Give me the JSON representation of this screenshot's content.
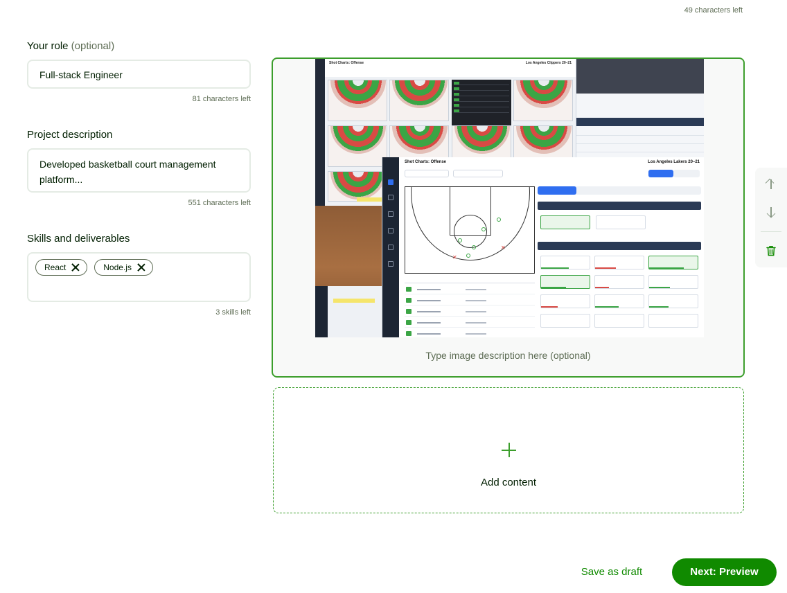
{
  "header": {
    "chars_left": "49 characters left"
  },
  "role": {
    "label": "Your role",
    "optional": "(optional)",
    "value": "Full-stack Engineer",
    "chars_left": "81 characters left"
  },
  "project": {
    "label": "Project description",
    "value": "Developed basketball court management platform...",
    "chars_left": "551 characters left"
  },
  "skills": {
    "label": "Skills and deliverables",
    "chips": [
      "React",
      "Node.js"
    ],
    "left": "3 skills left"
  },
  "image_block": {
    "screenshot_titles": {
      "offense_top": "Shot Charts: Offense",
      "clippers": "Los Angeles Clippers 20–21",
      "offense_main": "Shot Charts: Offense",
      "lakers": "Los Angeles Lakers 20–21"
    },
    "caption_placeholder": "Type image description here (optional)"
  },
  "add_block": {
    "label": "Add content",
    "icon": "plus-icon"
  },
  "toolbar": {
    "icons": [
      "arrow-up-icon",
      "arrow-down-icon",
      "trash-icon"
    ]
  },
  "footer": {
    "save_draft": "Save as draft",
    "next": "Next: Preview"
  },
  "colors": {
    "brand_green": "#108a00",
    "border_green": "#3c9e2c"
  }
}
